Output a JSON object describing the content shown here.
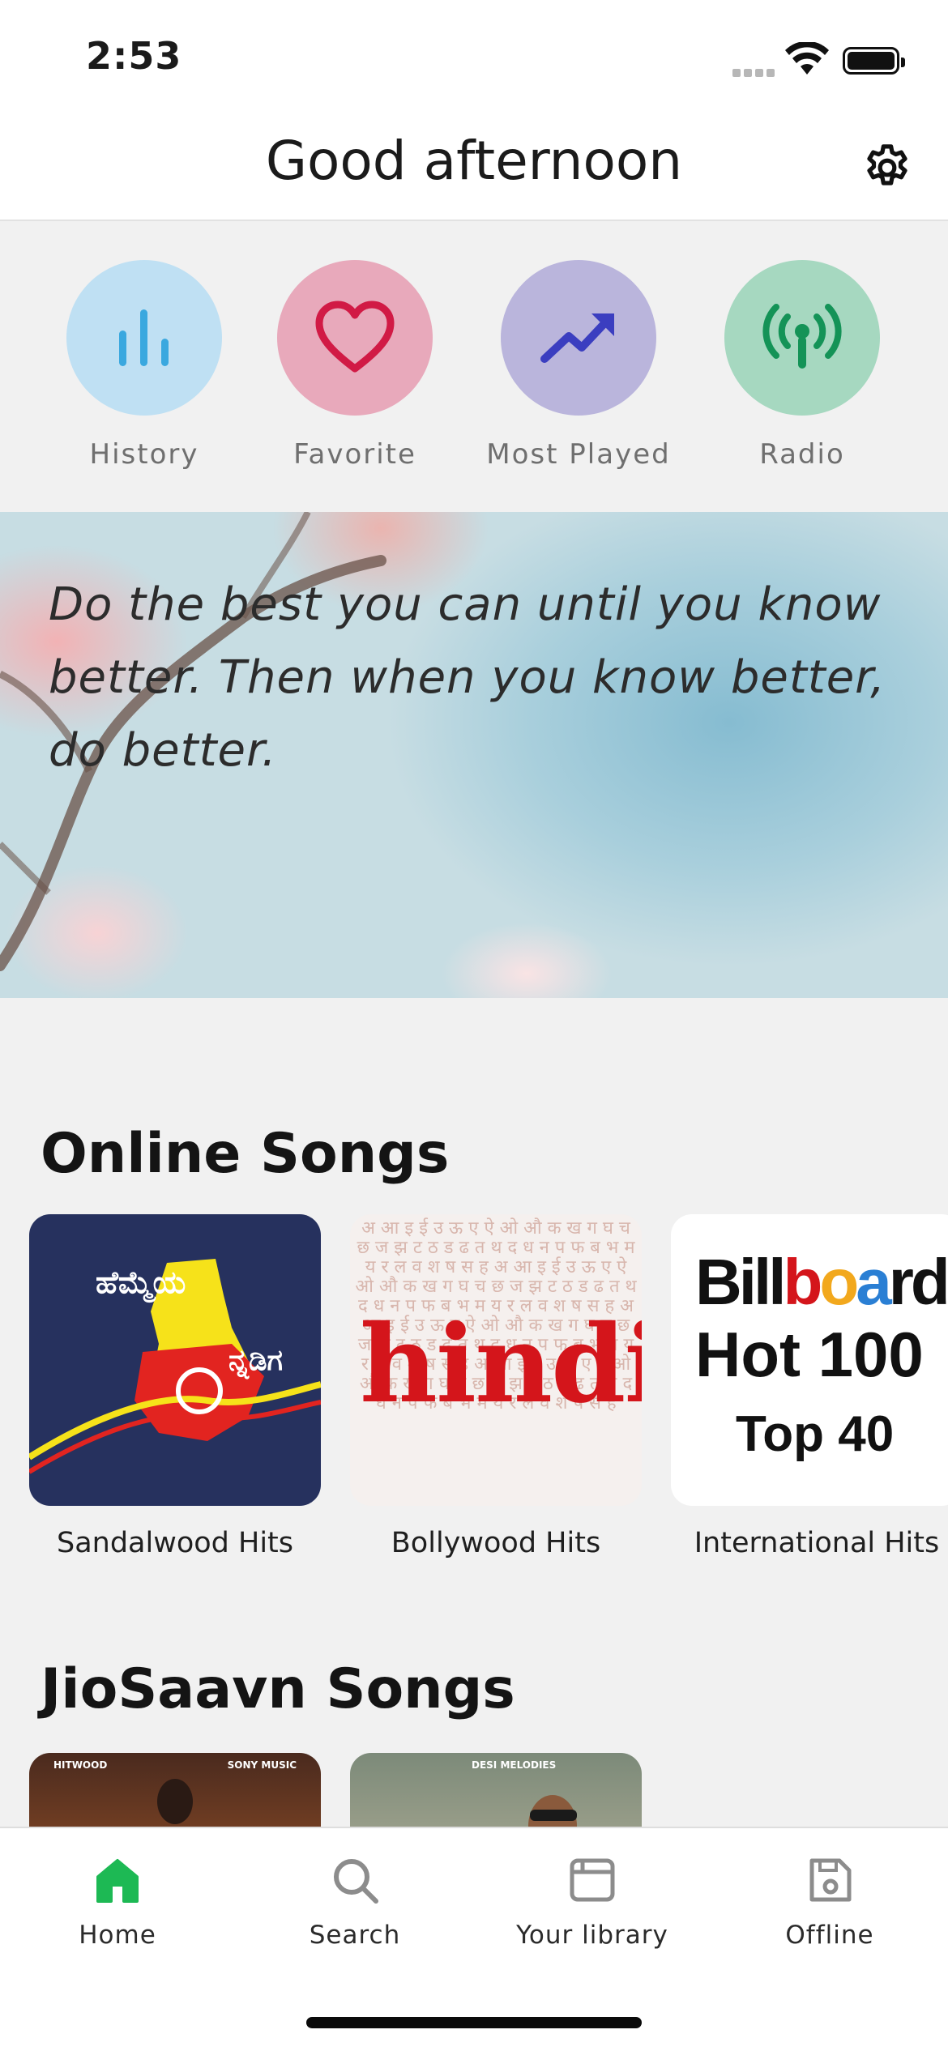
{
  "status_bar": {
    "time": "2:53"
  },
  "header": {
    "title": "Good afternoon",
    "settings_icon": "gear-icon"
  },
  "quick_actions": [
    {
      "label": "History",
      "icon": "bars-icon",
      "color": "#bfe0f3",
      "icon_color": "#3aa8df"
    },
    {
      "label": "Favorite",
      "icon": "heart-icon",
      "color": "#e8a9bb",
      "icon_color": "#d11a45"
    },
    {
      "label": "Most Played",
      "icon": "trending-up-icon",
      "color": "#bab5dc",
      "icon_color": "#3b3ec0"
    },
    {
      "label": "Radio",
      "icon": "broadcast-icon",
      "color": "#a6d8c0",
      "icon_color": "#149357"
    }
  ],
  "quote": {
    "text": "Do the best you can until you know better. Then when you know better, do better."
  },
  "online_songs": {
    "title": "Online Songs",
    "cards": [
      {
        "label": "Sandalwood Hits",
        "art_text_1": "ಹೆಮ್ಮೆಯ",
        "art_text_2": "ನ್ನಡಿಗ"
      },
      {
        "label": "Bollywood Hits",
        "art_text": "hindi",
        "art_bg_text": "अ आ इ ई उ ऊ ए ऐ ओ औ क ख ग घ च छ ज झ ट ठ ड ढ त थ द ध न प फ ब भ म य र ल व श ष स ह अ आ इ ई उ ऊ ए ऐ ओ औ क ख ग घ च छ ज झ ट ठ ड ढ त थ द ध न प फ ब भ म य र ल व श ष स ह अ आ इ ई उ ऊ ए ऐ ओ औ क ख ग घ च छ ज झ ट ठ ड ढ त थ द ध न प फ ब भ म य र ल व श ष स ह अ आ इ ई उ ऊ ए ऐ ओ औ क ख ग घ च छ ज झ ट ठ ड ढ त थ द ध न प फ ब भ म य र ल व श ष स ह"
      },
      {
        "label": "International Hits",
        "art_logo": "Billboard",
        "art_hot": "Hot 100",
        "art_top": "Top 40"
      }
    ]
  },
  "jiosaavn_songs": {
    "title": "JioSaavn Songs",
    "cards": [
      {
        "tag_left": "HITWOOD",
        "tag_right": "SONY MUSIC"
      },
      {
        "tag_left": "",
        "tag_right": "DESI MELODIES"
      }
    ]
  },
  "tab_bar": {
    "active_color": "#1db954",
    "items": [
      {
        "label": "Home",
        "icon": "home-icon",
        "active": true
      },
      {
        "label": "Search",
        "icon": "search-icon",
        "active": false
      },
      {
        "label": "Your library",
        "icon": "library-icon",
        "active": false
      },
      {
        "label": "Offline",
        "icon": "save-icon",
        "active": false
      }
    ]
  }
}
